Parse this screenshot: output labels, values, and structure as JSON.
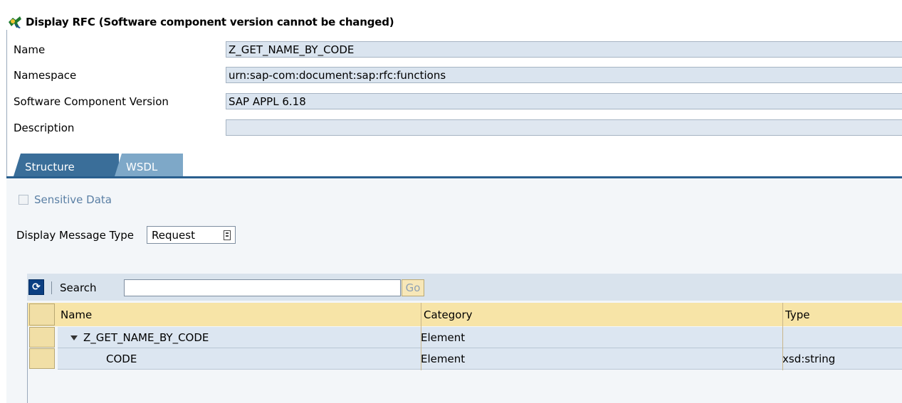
{
  "header": {
    "title": "Display RFC (Software component version cannot be changed)"
  },
  "fields": [
    {
      "label": "Name",
      "value": "Z_GET_NAME_BY_CODE"
    },
    {
      "label": "Namespace",
      "value": "urn:sap-com:document:sap:rfc:functions"
    },
    {
      "label": "Software Component Version",
      "value": "SAP APPL 6.18"
    },
    {
      "label": "Description",
      "value": ""
    }
  ],
  "tabs": [
    {
      "label": "Structure",
      "active": true
    },
    {
      "label": "WSDL",
      "active": false
    }
  ],
  "sensitive_data": {
    "label": "Sensitive Data",
    "checked": false
  },
  "message_type": {
    "label": "Display Message Type",
    "value": "Request"
  },
  "toolbar": {
    "search_label": "Search",
    "search_value": "",
    "go_label": "Go"
  },
  "table": {
    "columns": [
      "Name",
      "Category",
      "Type"
    ],
    "rows": [
      {
        "name": "Z_GET_NAME_BY_CODE",
        "category": "Element",
        "type": "",
        "expanded": true
      },
      {
        "name": "CODE",
        "category": "Element",
        "type": "xsd:string"
      }
    ]
  },
  "colors": {
    "tab_active": "#3a6e99",
    "tab_inactive": "#7ea8c8",
    "field_bg": "#dae4ef",
    "header_row": "#f7e4a7"
  }
}
